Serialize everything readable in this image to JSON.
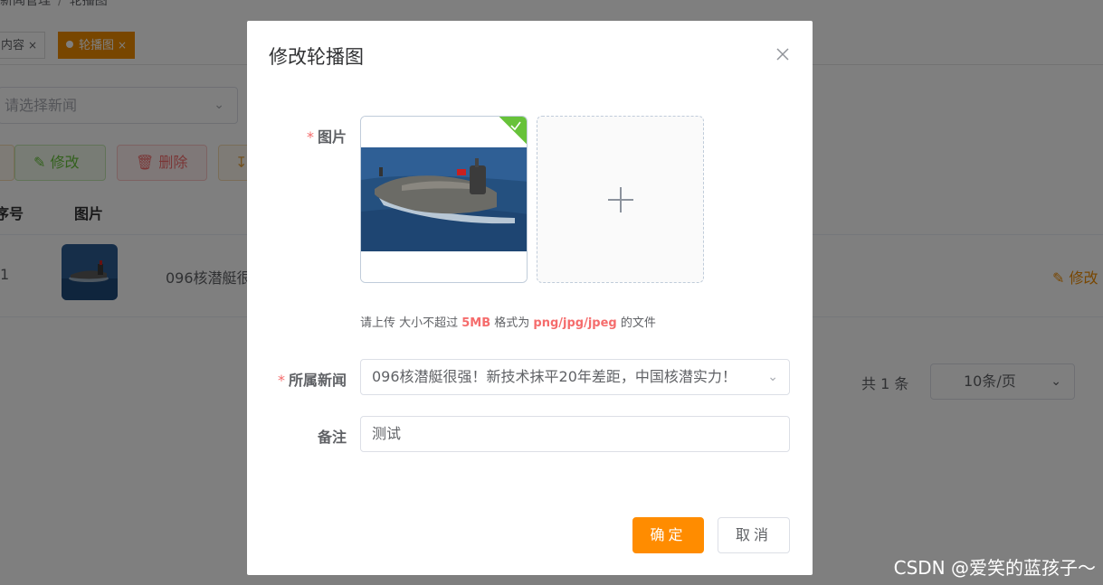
{
  "background": {
    "breadcrumb": [
      "新闻管理",
      "轮播图"
    ],
    "tags": [
      {
        "label": "内容",
        "close": "×"
      },
      {
        "label": "轮播图",
        "close": "×"
      }
    ],
    "filter": {
      "placeholder": "请选择新闻"
    },
    "toolbar": {
      "edit_label": "修改",
      "delete_label": "删除"
    },
    "table": {
      "headers": [
        "序号",
        "图片"
      ],
      "rows": [
        {
          "index": "1",
          "title": "096核潜艇很",
          "action": "修改"
        }
      ]
    },
    "pager": {
      "total": "共 1 条",
      "page_size": "10条/页"
    }
  },
  "dialog": {
    "title": "修改轮播图",
    "image_label": "图片",
    "required_mark": "*",
    "tip_prefix": "请上传 大小不超过 ",
    "tip_size": "5MB",
    "tip_mid": " 格式为 ",
    "tip_formats": "png/jpg/jpeg",
    "tip_suffix": " 的文件",
    "news_label": "所属新闻",
    "news_value": "096核潜艇很强！新技术抹平20年差距，中国核潜实力！",
    "remark_label": "备注",
    "remark_value": "测试",
    "confirm_label": "确定",
    "cancel_label": "取消"
  },
  "watermark": "CSDN @爱笑的蓝孩子～",
  "colors": {
    "primary": "#ff8c00",
    "success": "#67c23a",
    "danger": "#f56c6c",
    "mask": "rgba(0,0,0,0.5)"
  },
  "icons": [
    "close-icon",
    "check-icon",
    "plus-icon",
    "chevron-down-icon",
    "edit-icon",
    "delete-icon",
    "export-icon"
  ]
}
